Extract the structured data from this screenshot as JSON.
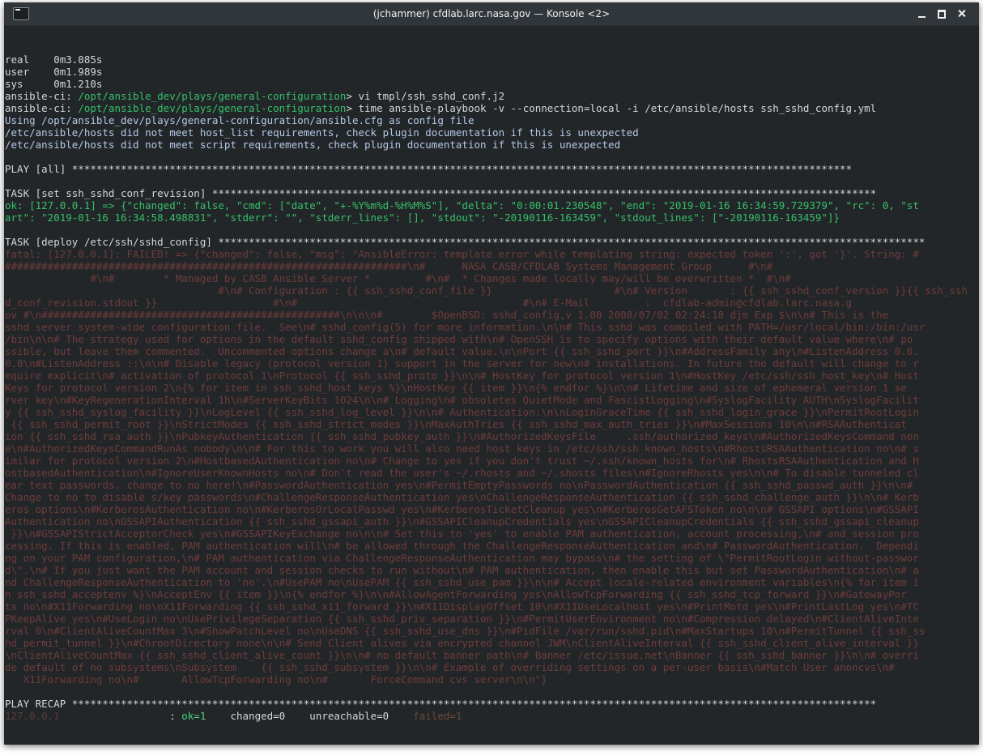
{
  "window": {
    "title": "(jchammer) cfdlab.larc.nasa.gov — Konsole <2>",
    "icon": "terminal-icon",
    "buttons": [
      "minimize-icon",
      "maximize-icon",
      "close-icon"
    ]
  },
  "colors": {
    "background": "#232629",
    "titlebar": "#31363b",
    "text": "#d4d7d9",
    "prompt_path": "#34c069",
    "info": "#b4c8e6",
    "error": "#6e3c3a",
    "ok": "#4fd080"
  },
  "terminal": {
    "time_real": "real    0m3.085s",
    "time_user": "user    0m1.989s",
    "time_sys": "sys     0m1.210s",
    "prompt_label": "ansible-ci: ",
    "prompt_path": "/opt/ansible_dev/plays/general-configuration",
    "cmd1": "> vi tmpl/ssh_sshd_conf.j2",
    "cmd2": "> time ansible-playbook -v --connection=local -i /etc/ansible/hosts ssh_sshd_config.yml",
    "info1": "Using /opt/ansible_dev/plays/general-configuration/ansible.cfg as config file",
    "info2": "/etc/ansible/hosts did not meet host_list requirements, check plugin documentation if this is unexpected",
    "info3": "/etc/ansible/hosts did not meet script requirements, check plugin documentation if this is unexpected",
    "play_header": "PLAY [all] ********************************************************************************************************************************",
    "task1_header": "TASK [set ssh_sshd_conf_revision] *************************************************************************************************************",
    "task1_ok_1": "ok: [127.0.0.1] => {\"changed\": false, \"cmd\": [\"date\", \"+-%Y%m%d-%H%M%S\"], \"delta\": \"0:00:01.230548\", \"end\": \"2019-01-16 16:34:59.729379\", \"rc\": 0, \"st",
    "task1_ok_2": "art\": \"2019-01-16 16:34:58.498831\", \"stderr\": \"\", \"stderr_lines\": [], \"stdout\": \"-20190116-163459\", \"stdout_lines\": [\"-20190116-163459\"]}",
    "task2_header": "TASK [deploy /etc/ssh/sshd_config] ********************************************************************************************************************",
    "fatal_lines": [
      "fatal: [127.0.0.1]: FAILED! => {\"changed\": false, \"msg\": \"AnsibleError: template error while templating string: expected token ':', got '}'. String: #",
      "##################################################################\\n#      NASA CASB/CFDLAB Systems Management Group      #\\n#",
      "              #\\n#        * Managed by CASB Ansible Server *         #\\n#  * Changes made locally may/will be overwritten *  #\\n#",
      "                                   #\\n# Configuration : {{ ssh_sshd_conf_file }}                    #\\n# Version       : {{ ssh_sshd_conf_version }}{{ ssh_ssh",
      "d_conf_revision.stdout }}                   #\\n#                                     #\\n# E-Mail         :  cfdlab-admin@cfdlab.larc.nasa.g",
      "ov #\\n#################################################\\n\\n\\n#        $OpenBSD: sshd_config,v 1.80 2008/07/02 02:24:18 djm Exp $\\n\\n# This is the",
      "sshd server system-wide configuration file.  See\\n# sshd_config(5) for more information.\\n\\n# This sshd was compiled with PATH=/usr/local/bin:/bin:/usr",
      "/bin\\n\\n# The strategy used for options in the default sshd_config shipped with\\n# OpenSSH is to specify options with their default value where\\n# po",
      "ssible, but leave them commented.  Uncommented options change a\\n# default value.\\n\\nPort {{ ssh_sshd_port }}\\n#AddressFamily any\\n#ListenAddress 0.0.",
      "0.0\\n#ListenAddress ::\\n\\n# Disable legacy (protocol version 1) support in the server for new\\n# installations. In future the default will change to r",
      "equire explicit\\n# activation of protocol 1\\nProtocol {{ ssh_sshd_proto }}\\n\\n# HostKey for protocol version 1\\n#HostKey /etc/ssh/ssh_host_key\\n# Host",
      "Keys for protocol version 2\\n{% for item in ssh_sshd_host_keys %}\\nHostKey {{ item }}\\n{% endfor %}\\n\\n# Lifetime and size of ephemeral version 1 se",
      "rver key\\n#KeyRegenerationInterval 1h\\n#ServerKeyBits 1024\\n\\n# Logging\\n# obsoletes QuietMode and FascistLogging\\n#SyslogFacility AUTH\\nSyslogFacilit",
      "y {{ ssh_sshd_syslog_facility }}\\nLogLevel {{ ssh_sshd_log_level }}\\n\\n# Authentication:\\n\\nLoginGraceTime {{ ssh_sshd_login_grace }}\\nPermitRootLogin",
      " {{ ssh_sshd_permit_root }}\\nStrictModes {{ ssh_sshd_strict_modes }}\\nMaxAuthTries {{ ssh_sshd_max_auth_tries }}\\n#MaxSessions 10\\n\\n#RSAAuthenticat",
      "ion {{ ssh_sshd_rsa_auth }}\\nPubkeyAuthentication {{ ssh_sshd_pubkey_auth }}\\n#AuthorizedKeysFile     .ssh/authorized_keys\\n#AuthorizedKeysCommand non",
      "e\\n#AuthorizedKeysCommandRunAs nobody\\n\\n# For this to work you will also need host keys in /etc/ssh/ssh_known_hosts\\n#RhostsRSAAuthentication no\\n# s",
      "imilar for protocol version 2\\n#HostbasedAuthentication no\\n# Change to yes if you don't trust ~/.ssh/known_hosts for\\n# RhostsRSAAuthentication and H",
      "ostbasedAuthentication\\n#IgnoreUserKnownHosts no\\n# Don't read the user's ~/.rhosts and ~/.shosts files\\n#IgnoreRhosts yes\\n\\n# To disable tunneled cl",
      "ear text passwords, change to no here!\\n#PasswordAuthentication yes\\n#PermitEmptyPasswords no\\nPasswordAuthentication {{ ssh_sshd_passwd_auth }}\\n\\n# ",
      "Change to no to disable s/key passwords\\n#ChallengeResponseAuthentication yes\\nChallengeResponseAuthentication {{ ssh_sshd_challenge_auth }}\\n\\n# Kerb",
      "eros options\\n#KerberosAuthentication no\\n#KerberosOrLocalPasswd yes\\n#KerberosTicketCleanup yes\\n#KerberosGetAFSToken no\\n\\n# GSSAPI options\\n#GSSAPI",
      "Authentication no\\nGSSAPIAuthentication {{ ssh_sshd_gssapi_auth }}\\n#GSSAPICleanupCredentials yes\\nGSSAPICleanupCredentials {{ ssh_sshd_gssapi_cleanup",
      " }}\\n#GSSAPIStrictAcceptorCheck yes\\n#GSSAPIKeyExchange no\\n\\n# Set this to 'yes' to enable PAM authentication, account processing,\\n# and session pro",
      "cessing. If this is enabled, PAM authentication will\\n# be allowed through the ChallengeResponseAuthentication and\\n# PasswordAuthentication.  Dependi",
      "ng on your PAM configuration,\\n# PAM authentication via ChallengeResponseAuthentication may bypass\\n# the setting of \\\"PermitRootLogin without-passwor",
      "d\\\".\\n# If you just want the PAM account and session checks to run without\\n# PAM authentication, then enable this but set PasswordAuthentication\\n# a",
      "nd ChallengeResponseAuthentication to 'no'.\\n#UsePAM no\\nUsePAM {{ ssh_sshd_use_pam }}\\n\\n# Accept locale-related environment variables\\n{% for item i",
      "n ssh_sshd_acceptenv %}\\nAcceptEnv {{ item }}\\n{% endfor %}\\n\\n#AllowAgentForwarding yes\\nAllowTcpForwarding {{ ssh_sshd_tcp_forward }}\\n#GatewayPor",
      "ts no\\n#X11Forwarding no\\nX11Forwarding {{ ssh_sshd_x11_forward }}\\n#X11DisplayOffset 10\\n#X11UseLocalhost yes\\n#PrintMotd yes\\n#PrintLastLog yes\\n#TC",
      "PKeepAlive yes\\n#UseLogin no\\nUsePrivilegeSeparation {{ ssh_sshd_priv_separation }}\\n#PermitUserEnvironment no\\n#Compression delayed\\n#ClientAliveInte",
      "rval 0\\n#ClientAliveCountMax 3\\n#ShowPatchLevel no\\nUseDNS {{ ssh_sshd_use_dns }}\\n#PidFile /var/run/sshd.pid\\n#MaxStartups 10\\n#PermitTunnel {{ ssh_ss",
      "hd_permit_tunnel }}\\n#ChrootDirectory none\\n\\n# Send Client alives via encrypted channel JWM\\nClientAliveInterval {{ ssh_sshd_client_alive_interval }}",
      "\\nClientAliveCountMax {{ ssh_sshd_client_alive_count }}\\n\\n# no default banner path\\n# Banner /etc/issue.net\\nBanner {{ ssh_sshd_banner }}\\n\\n# overri",
      "de default of no subsystems\\nSubsystem    {{ ssh_sshd_subsystem }}\\n\\n# Example of overriding settings on a per-user basis\\n#Match User anoncvs\\n#",
      "   X11Forwarding no\\n#       AllowTcpForwarding no\\n#       ForceCommand cvs server\\n\\n\"}"
    ],
    "recap_header": "PLAY RECAP ************************************************************************************************************************************",
    "recap_host": "127.0.0.1",
    "recap_sep": "                  : ",
    "recap_ok": "ok=1",
    "recap_changed": "    changed=0    unreachable=0    ",
    "recap_failed": "failed=1"
  }
}
